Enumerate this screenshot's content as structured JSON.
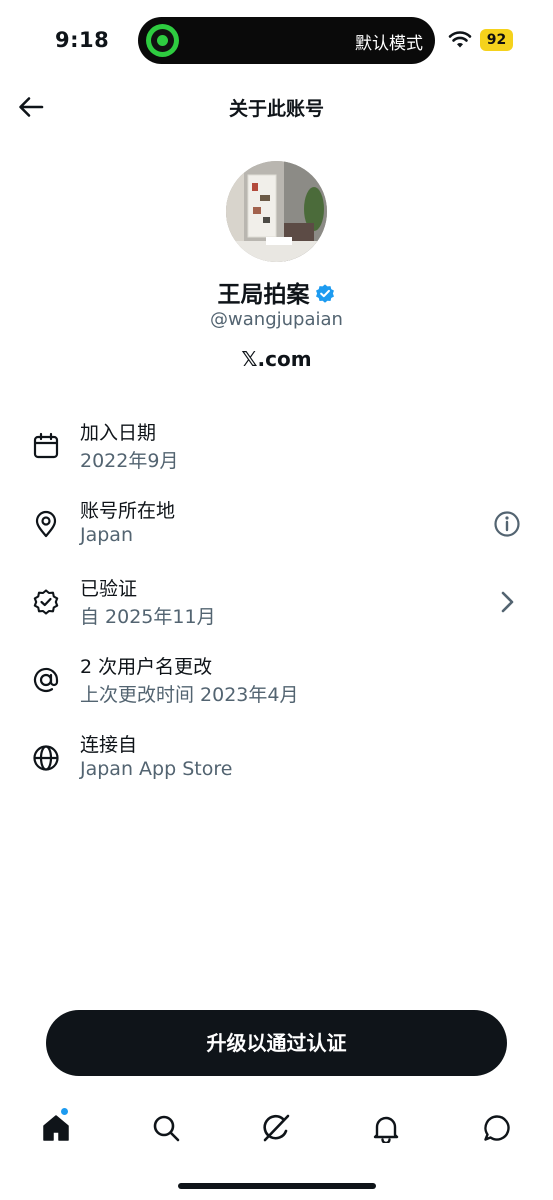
{
  "status_bar": {
    "time": "9:18",
    "island_label": "默认模式",
    "battery": "92",
    "battery_color": "#f5d21c"
  },
  "header": {
    "title": "关于此账号",
    "back_icon": "arrow-left-icon"
  },
  "profile": {
    "name": "王局拍案",
    "handle": "@wangjupaian",
    "site": "𝕏.com",
    "verified_color": "#1d9bf0"
  },
  "info": [
    {
      "icon": "calendar-icon",
      "title": "加入日期",
      "sub": "2022年9月"
    },
    {
      "icon": "location-pin-icon",
      "title": "账号所在地",
      "sub": "Japan",
      "trailing": "info-icon"
    },
    {
      "icon": "verified-check-icon",
      "title": "已验证",
      "sub": "自 2025年11月",
      "trailing": "chevron-right-icon"
    },
    {
      "icon": "at-sign-icon",
      "title": "2 次用户名更改",
      "sub": "上次更改时间 2023年4月"
    },
    {
      "icon": "globe-icon",
      "title": "连接自",
      "sub": "Japan App Store"
    }
  ],
  "cta": {
    "label": "升级以通过认证"
  },
  "tabs": [
    {
      "icon": "home-icon",
      "has_dot": true
    },
    {
      "icon": "search-icon"
    },
    {
      "icon": "grok-icon"
    },
    {
      "icon": "bell-icon"
    },
    {
      "icon": "chat-icon"
    }
  ],
  "colors": {
    "text_primary": "#0f1419",
    "text_secondary": "#536471",
    "accent": "#1d9bf0"
  }
}
